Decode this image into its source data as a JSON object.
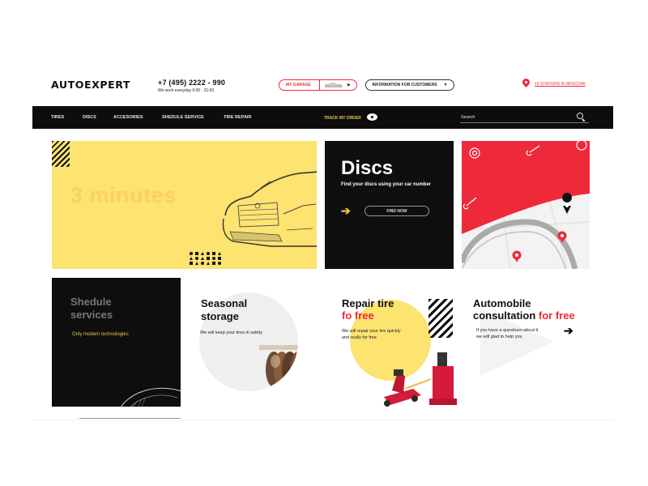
{
  "header": {
    "logo": "AUTOEXPERT",
    "phone": "+7 (495) 2222 - 990",
    "hours": "We work everyday  9:00 - 21:00",
    "garage_label": "MY GARAGE",
    "info_label": "INFORMATION FOR CUSTOMERS",
    "stations_label": "15 STATIONS IN MOSCOW"
  },
  "nav": {
    "items": [
      {
        "label": "TIRES"
      },
      {
        "label": "DISCS"
      },
      {
        "label": "ACCESORIES"
      },
      {
        "label": "SHEDULE SERVICE"
      },
      {
        "label": "TIRE REPAIR"
      }
    ],
    "track_label": "TRACK MY ORDER",
    "search_placeholder": "Search"
  },
  "tiles": {
    "promo": {
      "title": "3 minutes"
    },
    "discs": {
      "title": "Discs",
      "subtitle": "Find your discs using your car number",
      "button": "FIND NOW"
    },
    "shedule": {
      "title_line1": "Shedule",
      "title_line2": "services",
      "subtitle": "Only modern technologies"
    },
    "storage": {
      "title_line1": "Seasonal",
      "title_line2": "storage",
      "subtitle": "We will keep your tires in safety"
    },
    "repair": {
      "title_line1": "Repair tire",
      "title_line2": "fo free",
      "subtitle_line1": "We will repair your tire quickly",
      "subtitle_line2": "and really for free"
    },
    "consult": {
      "title_line1": "Automobile",
      "title_line2_a": "consultation",
      "title_line2_b": "for free",
      "subtitle_line1": "If you have a questiuon about it",
      "subtitle_line2": "we will glad to help you"
    }
  },
  "colors": {
    "accent_red": "#ee2a3a",
    "accent_yellow": "#fde36f",
    "dark": "#0e0e0e"
  }
}
